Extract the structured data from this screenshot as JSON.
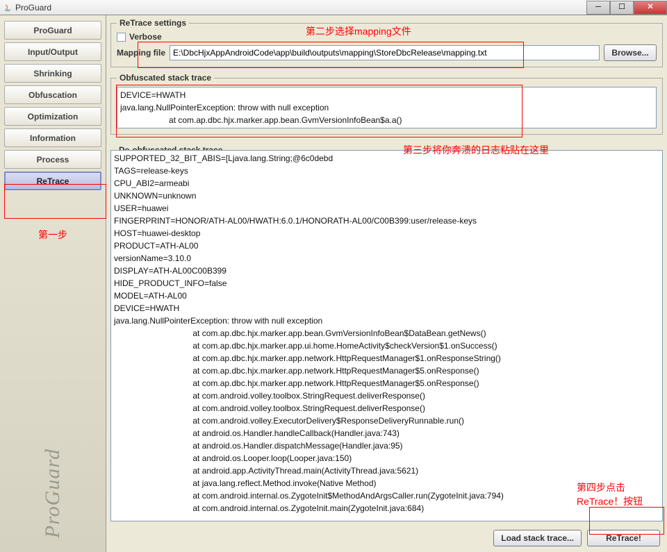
{
  "window": {
    "title": "ProGuard"
  },
  "sidebar": {
    "items": [
      {
        "label": "ProGuard"
      },
      {
        "label": "Input/Output"
      },
      {
        "label": "Shrinking"
      },
      {
        "label": "Obfuscation"
      },
      {
        "label": "Optimization"
      },
      {
        "label": "Information"
      },
      {
        "label": "Process"
      },
      {
        "label": "ReTrace"
      }
    ],
    "vertical_label": "ProGuard"
  },
  "settings": {
    "legend": "ReTrace settings",
    "verbose_label": "Verbose",
    "mapping_label": "Mapping file",
    "mapping_value": "E:\\DbcHjxAppAndroidCode\\app\\build\\outputs\\mapping\\StoreDbcRelease\\mapping.txt",
    "browse_label": "Browse..."
  },
  "obfuscated": {
    "legend": "Obfuscated stack trace",
    "content": "DEVICE=HWATH\njava.lang.NullPointerException: throw with null exception\n                     at com.ap.dbc.hjx.marker.app.bean.GvmVersionInfoBean$a.a()"
  },
  "deobfuscated": {
    "legend": "De-obfuscated stack trace",
    "content": "SUPPORTED_32_BIT_ABIS=[Ljava.lang.String;@6c0debd\nTAGS=release-keys\nCPU_ABI2=armeabi\nUNKNOWN=unknown\nUSER=huawei\nFINGERPRINT=HONOR/ATH-AL00/HWATH:6.0.1/HONORATH-AL00/C00B399:user/release-keys\nHOST=huawei-desktop\nPRODUCT=ATH-AL00\nversionName=3.10.0\nDISPLAY=ATH-AL00C00B399\nHIDE_PRODUCT_INFO=false\nMODEL=ATH-AL00\nDEVICE=HWATH\njava.lang.NullPointerException: throw with null exception\n                                  at com.ap.dbc.hjx.marker.app.bean.GvmVersionInfoBean$DataBean.getNews()\n                                  at com.ap.dbc.hjx.marker.app.ui.home.HomeActivity$checkVersion$1.onSuccess()\n                                  at com.ap.dbc.hjx.marker.app.network.HttpRequestManager$1.onResponseString()\n                                  at com.ap.dbc.hjx.marker.app.network.HttpRequestManager$5.onResponse()\n                                  at com.ap.dbc.hjx.marker.app.network.HttpRequestManager$5.onResponse()\n                                  at com.android.volley.toolbox.StringRequest.deliverResponse()\n                                  at com.android.volley.toolbox.StringRequest.deliverResponse()\n                                  at com.android.volley.ExecutorDelivery$ResponseDeliveryRunnable.run()\n                                  at android.os.Handler.handleCallback(Handler.java:743)\n                                  at android.os.Handler.dispatchMessage(Handler.java:95)\n                                  at android.os.Looper.loop(Looper.java:150)\n                                  at android.app.ActivityThread.main(ActivityThread.java:5621)\n                                  at java.lang.reflect.Method.invoke(Native Method)\n                                  at com.android.internal.os.ZygoteInit$MethodAndArgsCaller.run(ZygoteInit.java:794)\n                                  at com.android.internal.os.ZygoteInit.main(ZygoteInit.java:684)"
  },
  "buttons": {
    "load": "Load stack trace...",
    "retrace": "ReTrace!"
  },
  "annotations": {
    "step1": "第一步",
    "step2": "第二步选择mapping文件",
    "step3": "第三步将你奔溃的日志粘贴在这里",
    "step4a": "第四步点击",
    "step4b": "ReTrace！按钮"
  }
}
